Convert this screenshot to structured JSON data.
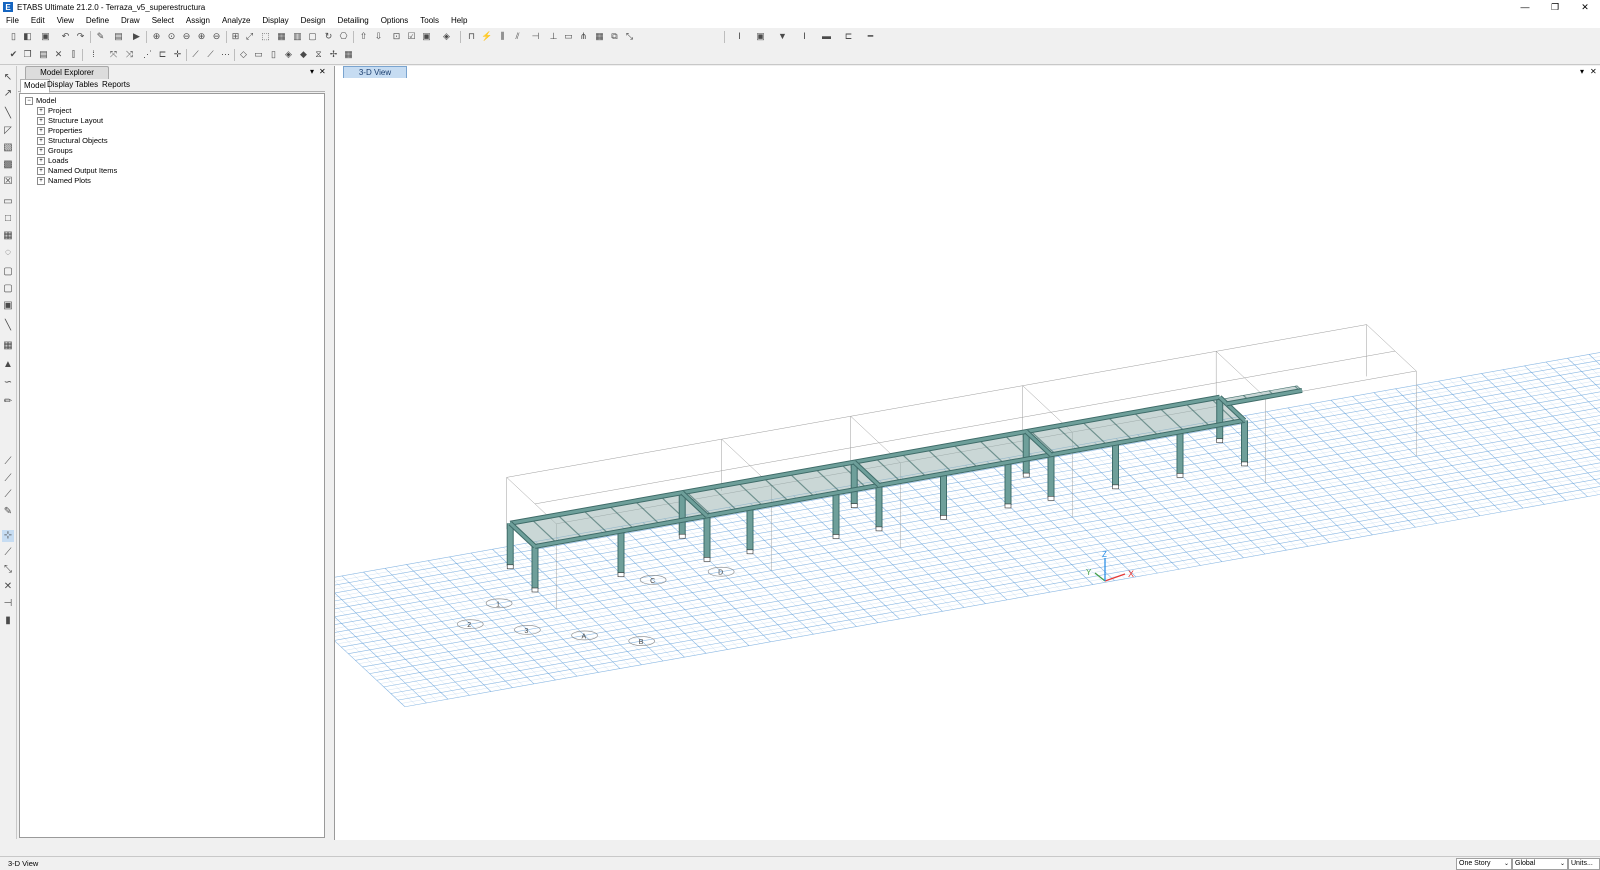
{
  "window": {
    "title": "ETABS Ultimate 21.2.0 - Terraza_v5_superestructura",
    "app_icon": "E"
  },
  "window_controls": {
    "minimize": "—",
    "restore": "❐",
    "close": "✕"
  },
  "menu": [
    "File",
    "Edit",
    "View",
    "Define",
    "Draw",
    "Select",
    "Assign",
    "Analyze",
    "Display",
    "Design",
    "Detailing",
    "Options",
    "Tools",
    "Help"
  ],
  "explorer": {
    "title": "Model Explorer",
    "pin": "▾",
    "close": "✕",
    "tabs": [
      "Model",
      "Display",
      "Tables",
      "Reports"
    ],
    "root": "Model",
    "root_expander": "−",
    "node_expander": "+",
    "items": [
      "Project",
      "Structure Layout",
      "Properties",
      "Structural Objects",
      "Groups",
      "Loads",
      "Named Output Items",
      "Named Plots"
    ]
  },
  "view": {
    "tab": "3-D View",
    "pin": "▾",
    "close": "✕"
  },
  "axes": {
    "x": "X",
    "y": "Y",
    "z": "Z"
  },
  "grid_bubbles": [
    "1",
    "2",
    "3",
    "A",
    "B",
    "C",
    "D"
  ],
  "status": {
    "left": "3-D View",
    "story": "One Story",
    "coord": "Global",
    "units": "Units...",
    "dropdown_arrow": "⌄"
  },
  "colors": {
    "frame": "#6e9f9a",
    "frame_dark": "#3f6c69",
    "slab": "#9eb7b4",
    "grid": "#5a9bd8",
    "accent": "#1565c0"
  }
}
